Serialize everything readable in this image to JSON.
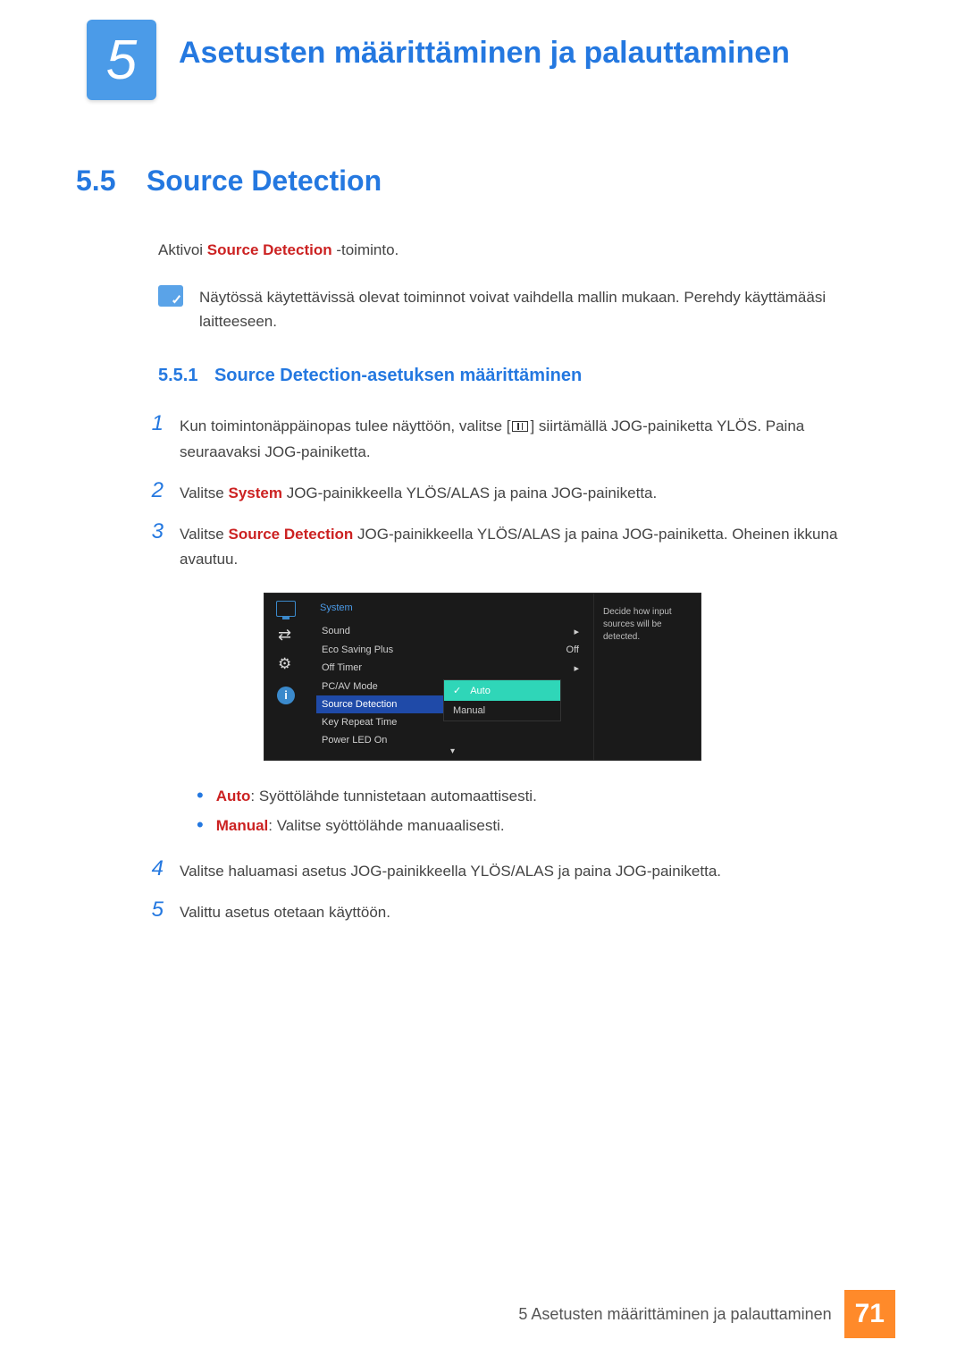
{
  "chapter": {
    "number": "5",
    "title": "Asetusten määrittäminen ja palauttaminen"
  },
  "section": {
    "number": "5.5",
    "title": "Source Detection"
  },
  "intro": {
    "p1a": "Aktivoi ",
    "p1b": "Source Detection",
    "p1c": " -toiminto.",
    "note": "Näytössä käytettävissä olevat toiminnot voivat vaihdella mallin mukaan. Perehdy käyttämääsi laitteeseen."
  },
  "subsection": {
    "number": "5.5.1",
    "title": "Source Detection-asetuksen määrittäminen"
  },
  "steps": {
    "s1": {
      "n": "1",
      "a": "Kun toimintonäppäinopas tulee näyttöön, valitse [",
      "b": "] siirtämällä JOG-painiketta YLÖS. Paina seuraavaksi JOG-painiketta."
    },
    "s2": {
      "n": "2",
      "a": "Valitse ",
      "emph": "System",
      "b": " JOG-painikkeella YLÖS/ALAS ja paina JOG-painiketta."
    },
    "s3": {
      "n": "3",
      "a": "Valitse ",
      "emph": "Source Detection",
      "b": " JOG-painikkeella YLÖS/ALAS ja paina JOG-painiketta. Oheinen ikkuna avautuu."
    },
    "s4": {
      "n": "4",
      "t": "Valitse haluamasi asetus JOG-painikkeella YLÖS/ALAS ja paina JOG-painiketta."
    },
    "s5": {
      "n": "5",
      "t": "Valittu asetus otetaan käyttöön."
    }
  },
  "osd": {
    "category": "System",
    "rows": {
      "sound": {
        "label": "Sound",
        "value": "▸"
      },
      "eco": {
        "label": "Eco Saving Plus",
        "value": "Off"
      },
      "offtimer": {
        "label": "Off Timer",
        "value": "▸"
      },
      "pcav": {
        "label": "PC/AV Mode",
        "value": ""
      },
      "srcdet": {
        "label": "Source Detection",
        "value": ""
      },
      "keyrep": {
        "label": "Key Repeat Time",
        "value": ""
      },
      "power": {
        "label": "Power LED On",
        "value": ""
      }
    },
    "popup": {
      "auto": "Auto",
      "manual": "Manual"
    },
    "help": "Decide how input sources will be detected.",
    "info_letter": "i"
  },
  "bullets": {
    "b1": {
      "emph": "Auto",
      "t": ": Syöttölähde tunnistetaan automaattisesti."
    },
    "b2": {
      "emph": "Manual",
      "t": ": Valitse syöttölähde manuaalisesti."
    }
  },
  "footer": {
    "text": "5 Asetusten määrittäminen ja palauttaminen",
    "page": "71"
  }
}
